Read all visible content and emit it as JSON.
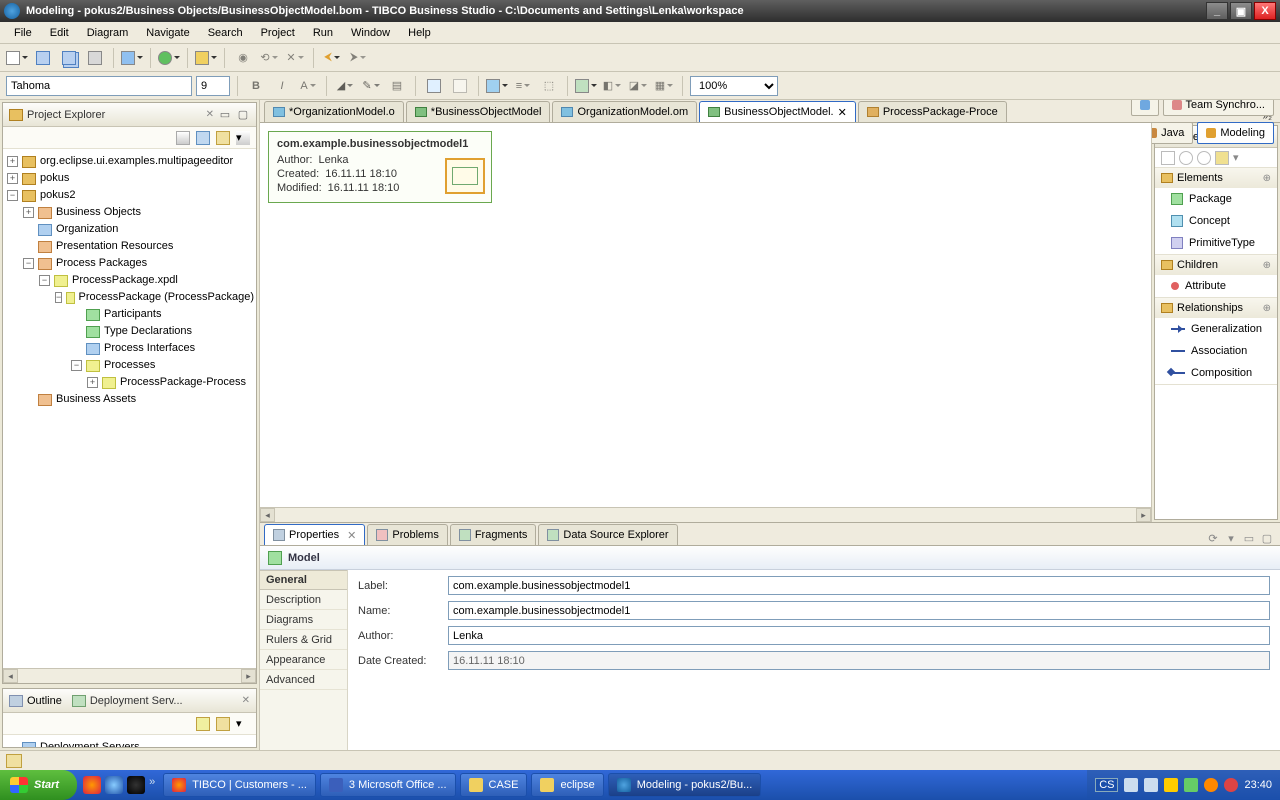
{
  "window": {
    "title": "Modeling - pokus2/Business Objects/BusinessObjectModel.bom - TIBCO Business Studio - C:\\Documents and Settings\\Lenka\\workspace"
  },
  "menu": [
    "File",
    "Edit",
    "Diagram",
    "Navigate",
    "Search",
    "Project",
    "Run",
    "Window",
    "Help"
  ],
  "font": {
    "name": "Tahoma",
    "size": "9",
    "zoom": "100%"
  },
  "perspectives": {
    "team": "Team Synchro...",
    "java": "Java",
    "modeling": "Modeling"
  },
  "explorer": {
    "title": "Project Explorer",
    "root1": "org.eclipse.ui.examples.multipageeditor",
    "root2": "pokus",
    "root3": "pokus2",
    "bo": "Business Objects",
    "org": "Organization",
    "pres": "Presentation Resources",
    "pp": "Process Packages",
    "ppx": "ProcessPackage.xpdl",
    "ppp": "ProcessPackage (ProcessPackage)",
    "part": "Participants",
    "td": "Type Declarations",
    "pi": "Process Interfaces",
    "procs": "Processes",
    "procitem": "ProcessPackage-Process",
    "ba": "Business Assets"
  },
  "outline": {
    "title": "Outline"
  },
  "deploy": {
    "title": "Deployment Serv...",
    "server": "Deployment Servers"
  },
  "editors": {
    "t1": "*OrganizationModel.o",
    "t2": "*BusinessObjectModel",
    "t3": "OrganizationModel.om",
    "t4": "BusinessObjectModel.",
    "t5": "ProcessPackage-Proce",
    "more": "»₂"
  },
  "model_card": {
    "title": "com.example.businessobjectmodel1",
    "author_l": "Author:",
    "author_v": "Lenka",
    "created_l": "Created:",
    "created_v": "16.11.11 18:10",
    "modified_l": "Modified:",
    "modified_v": "16.11.11 18:10"
  },
  "palette": {
    "title": "Palette",
    "s1": "Elements",
    "i1": "Package",
    "i2": "Concept",
    "i3": "PrimitiveType",
    "s2": "Children",
    "i4": "Attribute",
    "s3": "Relationships",
    "i5": "Generalization",
    "i6": "Association",
    "i7": "Composition"
  },
  "bottom_tabs": {
    "properties": "Properties",
    "problems": "Problems",
    "fragments": "Fragments",
    "dse": "Data Source Explorer"
  },
  "props": {
    "heading": "Model",
    "cats": [
      "General",
      "Description",
      "Diagrams",
      "Rulers & Grid",
      "Appearance",
      "Advanced"
    ],
    "label_l": "Label:",
    "label_v": "com.example.businessobjectmodel1",
    "name_l": "Name:",
    "name_v": "com.example.businessobjectmodel1",
    "author_l": "Author:",
    "author_v": "Lenka",
    "date_l": "Date Created:",
    "date_v": "16.11.11 18:10"
  },
  "taskbar": {
    "start": "Start",
    "t1": "TIBCO | Customers - ...",
    "t2": "3 Microsoft Office ...",
    "t3": "CASE",
    "t4": "eclipse",
    "t5": "Modeling - pokus2/Bu...",
    "lang": "CS",
    "clock": "23:40"
  }
}
